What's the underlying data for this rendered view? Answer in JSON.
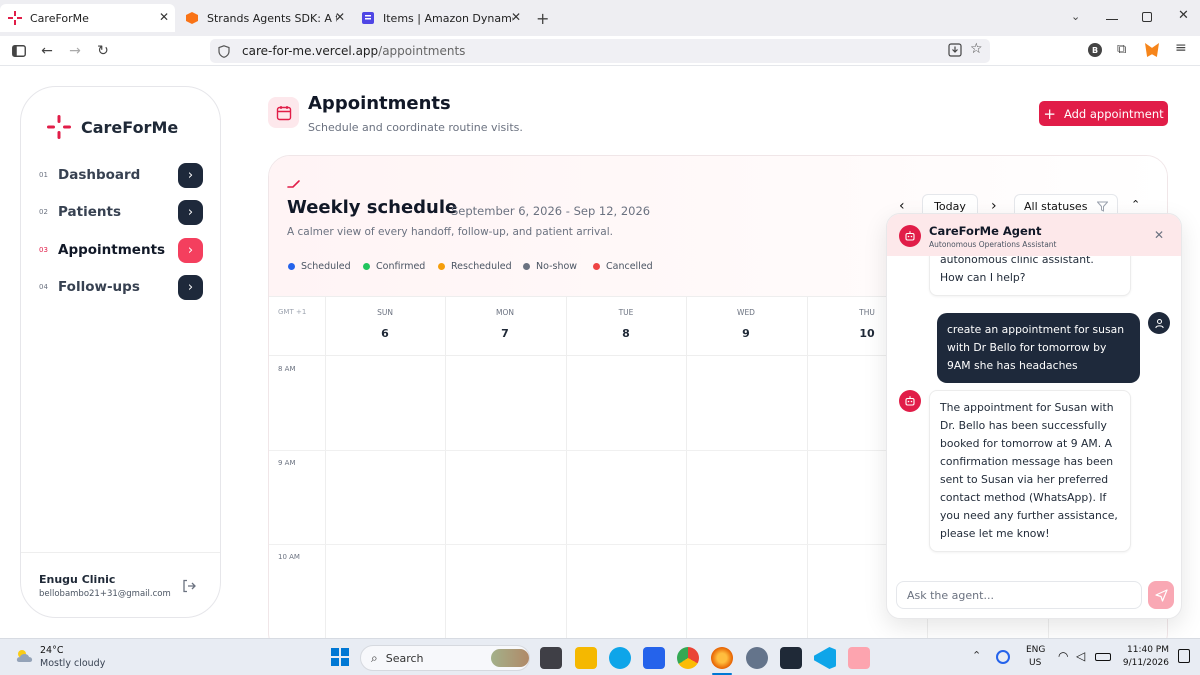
{
  "browser": {
    "tabs": [
      {
        "title": "CareForMe",
        "active": true
      },
      {
        "title": "Strands Agents SDK: A technical",
        "active": false
      },
      {
        "title": "Items | Amazon DynamoDB Ma",
        "active": false
      }
    ],
    "url_host": "care-for-me.vercel.app",
    "url_path": "/appointments"
  },
  "sidebar": {
    "brand": "CareForMe",
    "items": [
      {
        "num": "01",
        "label": "Dashboard",
        "active": false
      },
      {
        "num": "02",
        "label": "Patients",
        "active": false
      },
      {
        "num": "03",
        "label": "Appointments",
        "active": true
      },
      {
        "num": "04",
        "label": "Follow-ups",
        "active": false
      }
    ],
    "clinic_name": "Enugu Clinic",
    "email": "bellobambo21+31@gmail.com"
  },
  "header": {
    "title": "Appointments",
    "subtitle": "Schedule and coordinate routine visits.",
    "add_button": "Add appointment"
  },
  "schedule": {
    "title": "Weekly schedule",
    "date_range": "September 6, 2026 - Sep 12, 2026",
    "subtitle": "A calmer view of every handoff, follow-up, and patient arrival.",
    "today_label": "Today",
    "status_filter": "All statuses",
    "legend": [
      {
        "label": "Scheduled",
        "color": "#2563eb"
      },
      {
        "label": "Confirmed",
        "color": "#22c55e"
      },
      {
        "label": "Rescheduled",
        "color": "#f59e0b"
      },
      {
        "label": "No-show",
        "color": "#6b7280"
      },
      {
        "label": "Cancelled",
        "color": "#ef4444"
      }
    ],
    "timezone": "GMT +1",
    "days": [
      {
        "name": "SUN",
        "num": "6"
      },
      {
        "name": "MON",
        "num": "7"
      },
      {
        "name": "TUE",
        "num": "8"
      },
      {
        "name": "WED",
        "num": "9"
      },
      {
        "name": "THU",
        "num": "10"
      }
    ],
    "hours": [
      "8 AM",
      "9 AM",
      "10 AM"
    ]
  },
  "chat": {
    "title": "CareForMe Agent",
    "subtitle": "Autonomous Operations Assistant",
    "messages": [
      {
        "role": "bot",
        "text": "autonomous clinic assistant. How can I help?"
      },
      {
        "role": "user",
        "text": "create an appointment for susan with Dr Bello for tomorrow  by 9AM she has headaches"
      },
      {
        "role": "bot",
        "text": "The appointment for Susan with Dr. Bello has been successfully booked for tomorrow at 9 AM. A confirmation message has been sent to Susan via her preferred contact method (WhatsApp). If you need any further assistance, please let me know!"
      }
    ],
    "input_placeholder": "Ask the agent..."
  },
  "taskbar": {
    "temperature": "24°C",
    "weather": "Mostly cloudy",
    "search_label": "Search",
    "lang_line1": "ENG",
    "lang_line2": "US",
    "time": "11:40 PM",
    "date": "9/11/2026"
  },
  "colors": {
    "brand": "#e11d48",
    "navy": "#1e293b"
  }
}
